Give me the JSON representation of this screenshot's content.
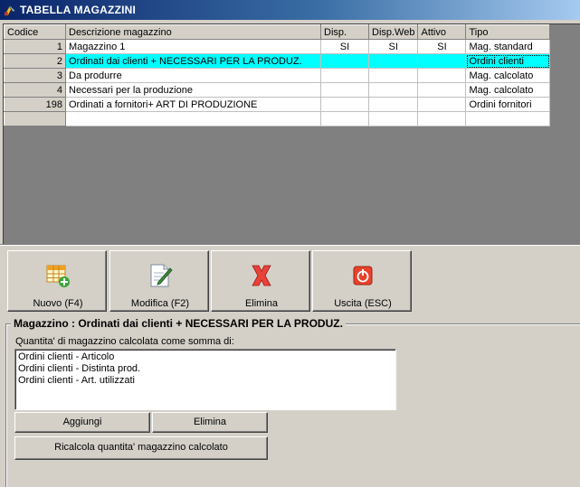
{
  "window": {
    "title": "TABELLA MAGAZZINI",
    "icon": "app-icon"
  },
  "grid": {
    "columns": [
      "Codice",
      "Descrizione magazzino",
      "Disp.",
      "Disp.Web",
      "Attivo",
      "Tipo"
    ],
    "rows": [
      {
        "codice": "1",
        "descrizione": "Magazzino 1",
        "disp": "SI",
        "disp_web": "SI",
        "attivo": "SI",
        "tipo": "Mag. standard",
        "selected": false
      },
      {
        "codice": "2",
        "descrizione": "Ordinati dai clienti + NECESSARI  PER LA PRODUZ.",
        "disp": "",
        "disp_web": "",
        "attivo": "",
        "tipo": "Ordini clienti",
        "selected": true
      },
      {
        "codice": "3",
        "descrizione": "Da produrre",
        "disp": "",
        "disp_web": "",
        "attivo": "",
        "tipo": "Mag. calcolato",
        "selected": false
      },
      {
        "codice": "4",
        "descrizione": "Necessari per la produzione",
        "disp": "",
        "disp_web": "",
        "attivo": "",
        "tipo": "Mag. calcolato",
        "selected": false
      },
      {
        "codice": "198",
        "descrizione": "Ordinati a fornitori+ ART DI PRODUZIONE",
        "disp": "",
        "disp_web": "",
        "attivo": "",
        "tipo": "Ordini fornitori",
        "selected": false
      }
    ]
  },
  "toolbar": {
    "nuovo": "Nuovo (F4)",
    "modifica": "Modifica (F2)",
    "elimina": "Elimina",
    "uscita": "Uscita (ESC)"
  },
  "detail": {
    "title": "Magazzino : Ordinati dai clienti + NECESSARI  PER LA PRODUZ.",
    "sublabel": "Quantita' di magazzino calcolata come somma di:",
    "items": [
      "Ordini clienti - Articolo",
      "Ordini clienti - Distinta prod.",
      "Ordini clienti - Art. utilizzati"
    ],
    "add_button": "Aggiungi",
    "delete_button": "Elimina",
    "recalc_button": "Ricalcola quantita' magazzino calcolato"
  },
  "colors": {
    "selection": "#00ffff",
    "titlebar_start": "#0a246a",
    "titlebar_end": "#a6caf0",
    "delete_icon": "#e8423a",
    "exit_icon": "#e8422a"
  }
}
